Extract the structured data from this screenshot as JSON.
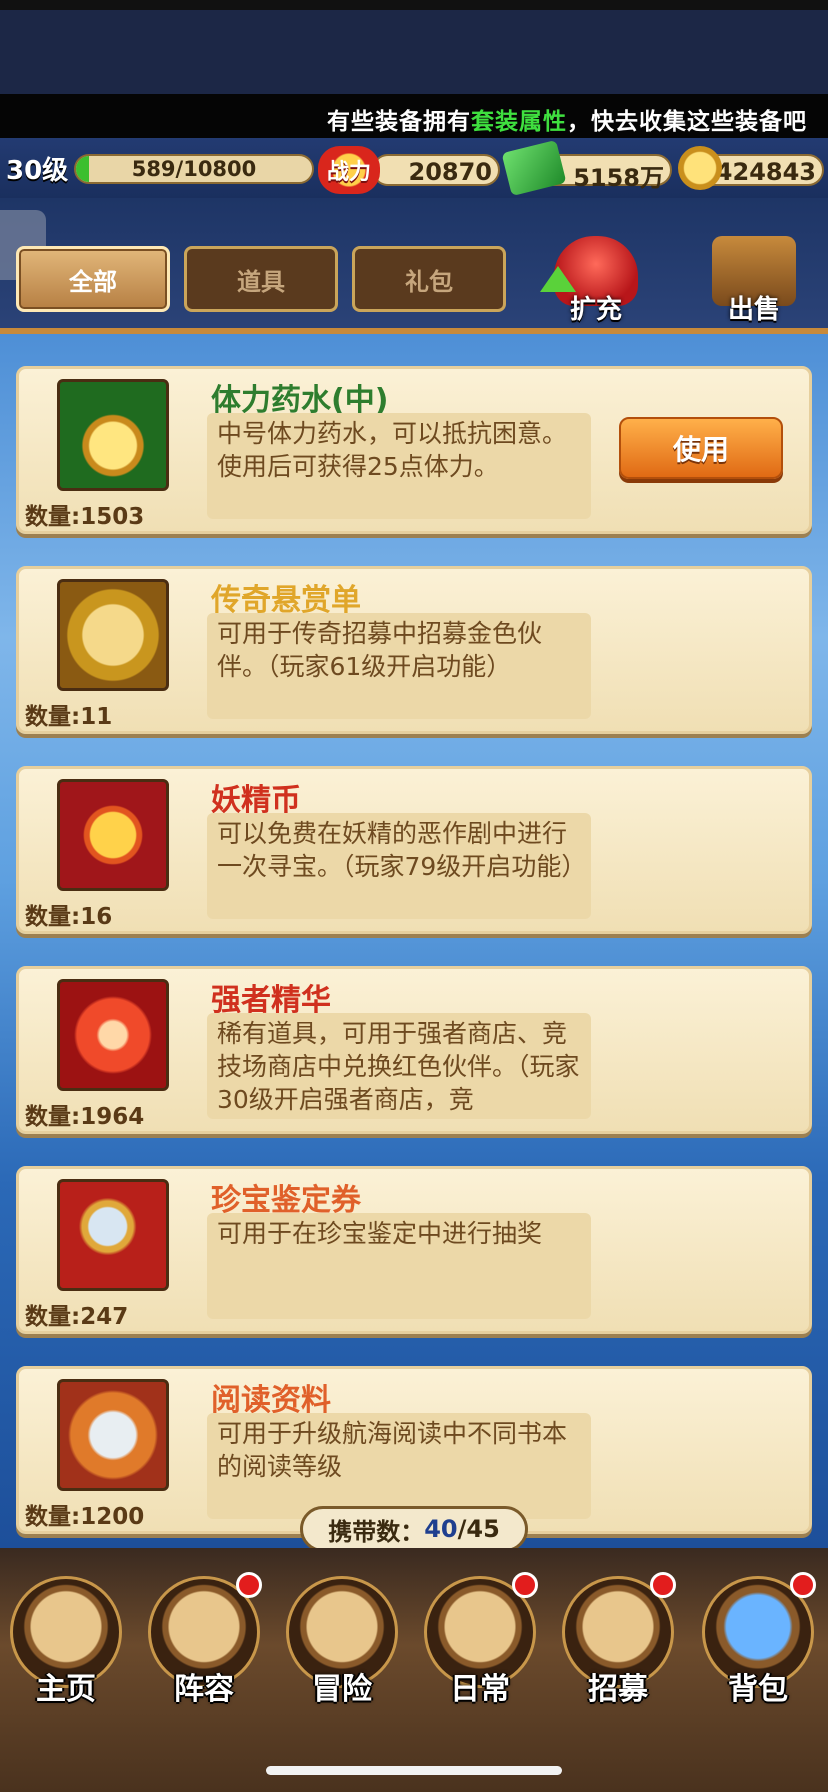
{
  "ticker": {
    "prefix": "有些装备拥有",
    "highlight": "套装属性",
    "suffix": "，快去收集这些装备吧"
  },
  "status": {
    "level": "30级",
    "xp_text": "589/10800",
    "xp_progress": 0.0545,
    "power_icon": "战力",
    "power": "20870",
    "money": "5158万",
    "coins": "424843"
  },
  "tabs": [
    {
      "label": "全部",
      "active": true
    },
    {
      "label": "道具",
      "active": false
    },
    {
      "label": "礼包",
      "active": false
    }
  ],
  "actions": {
    "expand_label": "扩充",
    "sell_label": "出售"
  },
  "items": [
    {
      "name": "体力药水(中)",
      "name_color": "#2e7d2e",
      "desc": "中号体力药水，可以抵抗困意。使用后可获得25点体力。",
      "qty": "数量:1503",
      "use_label": "使用",
      "icon": "potion-icon"
    },
    {
      "name": "传奇悬赏单",
      "name_color": "#e0a62a",
      "desc": "可用于传奇招募中招募金色伙伴。（玩家61级开启功能）",
      "qty": "数量:11",
      "icon": "wanted-poster-icon"
    },
    {
      "name": "妖精币",
      "name_color": "#d0301e",
      "desc": "可以免费在妖精的恶作剧中进行一次寻宝。（玩家79级开启功能）",
      "qty": "数量:16",
      "icon": "fairy-coin-icon"
    },
    {
      "name": "强者精华",
      "name_color": "#d0301e",
      "desc": "稀有道具，可用于强者商店、竞技场商店中兑换红色伙伴。（玩家30级开启强者商店，竞",
      "qty": "数量:1964",
      "icon": "crystal-icon"
    },
    {
      "name": "珍宝鉴定券",
      "name_color": "#e0602a",
      "desc": "可用于在珍宝鉴定中进行抽奖",
      "qty": "数量:247",
      "icon": "magnifier-icon"
    },
    {
      "name": "阅读资料",
      "name_color": "#e0602a",
      "desc": "可用于升级航海阅读中不同书本的阅读等级",
      "qty": "数量:1200",
      "icon": "document-icon"
    }
  ],
  "carry": {
    "label": "携带数：",
    "current": "40",
    "max": "/45"
  },
  "nav": [
    {
      "label": "主页",
      "icon": "home-icon",
      "badge": false
    },
    {
      "label": "阵容",
      "icon": "formation-icon",
      "badge": true
    },
    {
      "label": "冒险",
      "icon": "skull-icon",
      "badge": false
    },
    {
      "label": "日常",
      "icon": "swords-icon",
      "badge": true
    },
    {
      "label": "招募",
      "icon": "tavern-icon",
      "badge": true
    },
    {
      "label": "背包",
      "icon": "bag-icon",
      "badge": true
    }
  ]
}
